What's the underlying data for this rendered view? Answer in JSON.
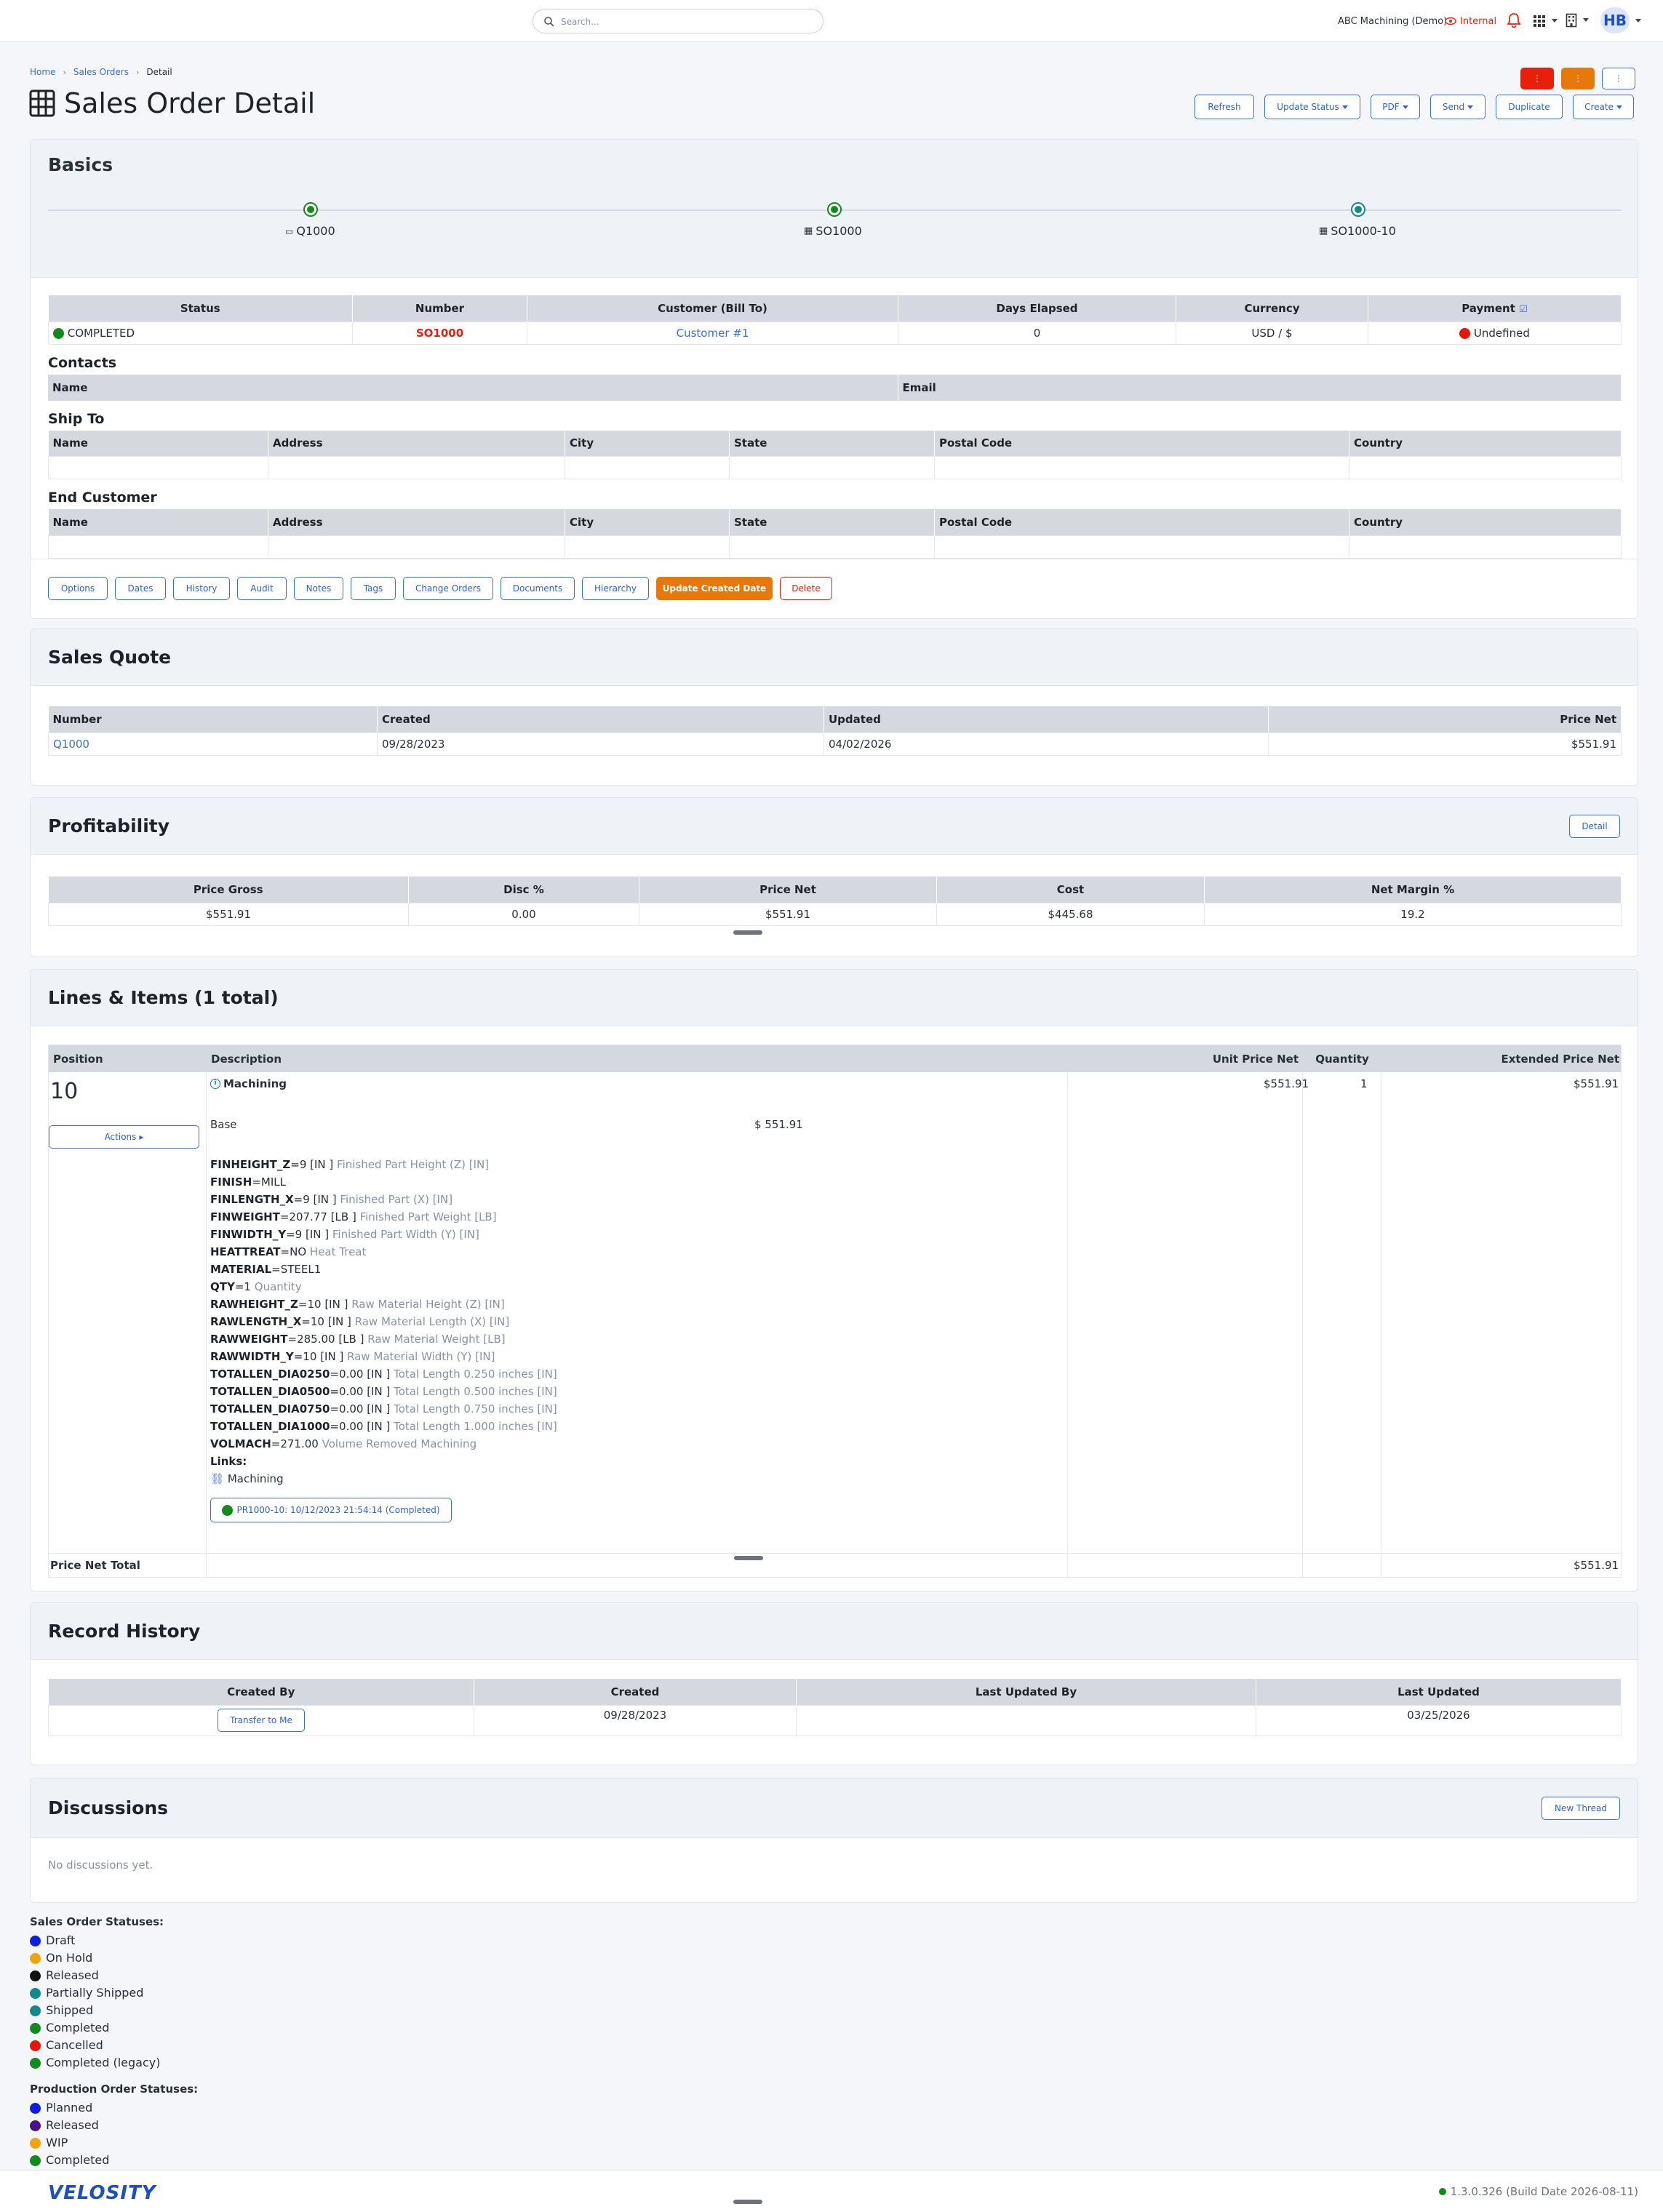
{
  "topbar": {
    "search_placeholder": "Search...",
    "company": "ABC Machining (Demo)",
    "internal_label": "Internal",
    "avatar": "HB"
  },
  "breadcrumb": [
    "Home",
    "Sales Orders",
    "Detail"
  ],
  "page_title": "Sales Order Detail",
  "header_buttons": {
    "refresh": "Refresh",
    "update_status": "Update Status",
    "pdf": "PDF",
    "send": "Send",
    "duplicate": "Duplicate",
    "create": "Create"
  },
  "basics": {
    "title": "Basics",
    "steps": [
      {
        "label": "Q1000"
      },
      {
        "label": "SO1000"
      },
      {
        "label": "SO1000-10"
      }
    ],
    "columns": [
      "Status",
      "Number",
      "Customer (Bill To)",
      "Days Elapsed",
      "Currency",
      "Payment"
    ],
    "row": {
      "status": "COMPLETED",
      "number": "SO1000",
      "customer": "Customer #1",
      "days": "0",
      "currency": "USD / $",
      "payment": "Undefined"
    },
    "contacts_title": "Contacts",
    "contacts_columns": [
      "Name",
      "Email"
    ],
    "ship_title": "Ship To",
    "end_title": "End Customer",
    "address_columns": [
      "Name",
      "Address",
      "City",
      "State",
      "Postal Code",
      "Country"
    ],
    "actions": [
      "Options",
      "Dates",
      "History",
      "Audit",
      "Notes",
      "Tags",
      "Change Orders",
      "Documents",
      "Hierarchy"
    ],
    "update_created_date": "Update Created Date",
    "delete": "Delete"
  },
  "sales_quote": {
    "title": "Sales Quote",
    "columns": [
      "Number",
      "Created",
      "Updated",
      "Price Net"
    ],
    "row": {
      "number": "Q1000",
      "created": "09/28/2023",
      "updated": "04/02/2026",
      "price_net": "$551.91"
    }
  },
  "profitability": {
    "title": "Profitability",
    "detail": "Detail",
    "columns": [
      "Price Gross",
      "Disc %",
      "Price Net",
      "Cost",
      "Net Margin %"
    ],
    "row": [
      "$551.91",
      "0.00",
      "$551.91",
      "$445.68",
      "19.2"
    ]
  },
  "lines": {
    "title": "Lines & Items (1 total)",
    "columns": [
      "Position",
      "Description",
      "Unit Price Net",
      "Quantity",
      "Extended Price Net"
    ],
    "position": "10",
    "actions": "Actions",
    "item_name": "Machining",
    "unit_price": "$551.91",
    "quantity": "1",
    "extended": "$551.91",
    "base_label": "Base",
    "base_value": "$ 551.91",
    "params": [
      {
        "k": "FINHEIGHT_Z",
        "v": "=9 [IN ]",
        "d": "Finished Part Height (Z) [IN]"
      },
      {
        "k": "FINISH",
        "v": "=MILL",
        "d": ""
      },
      {
        "k": "FINLENGTH_X",
        "v": "=9 [IN ]",
        "d": "Finished Part (X) [IN]"
      },
      {
        "k": "FINWEIGHT",
        "v": "=207.77 [LB ]",
        "d": "Finished Part Weight [LB]"
      },
      {
        "k": "FINWIDTH_Y",
        "v": "=9 [IN ]",
        "d": "Finished Part Width (Y) [IN]"
      },
      {
        "k": "HEATTREAT",
        "v": "=NO",
        "d": "Heat Treat"
      },
      {
        "k": "MATERIAL",
        "v": "=STEEL1",
        "d": ""
      },
      {
        "k": "QTY",
        "v": "=1",
        "d": "Quantity"
      },
      {
        "k": "RAWHEIGHT_Z",
        "v": "=10 [IN ]",
        "d": "Raw Material Height (Z) [IN]"
      },
      {
        "k": "RAWLENGTH_X",
        "v": "=10 [IN ]",
        "d": "Raw Material Length (X) [IN]"
      },
      {
        "k": "RAWWEIGHT",
        "v": "=285.00 [LB ]",
        "d": "Raw Material Weight [LB]"
      },
      {
        "k": "RAWWIDTH_Y",
        "v": "=10 [IN ]",
        "d": "Raw Material Width (Y) [IN]"
      },
      {
        "k": "TOTALLEN_DIA0250",
        "v": "=0.00 [IN ]",
        "d": "Total Length 0.250 inches [IN]"
      },
      {
        "k": "TOTALLEN_DIA0500",
        "v": "=0.00 [IN ]",
        "d": "Total Length 0.500 inches [IN]"
      },
      {
        "k": "TOTALLEN_DIA0750",
        "v": "=0.00 [IN ]",
        "d": "Total Length 0.750 inches [IN]"
      },
      {
        "k": "TOTALLEN_DIA1000",
        "v": "=0.00 [IN ]",
        "d": "Total Length 1.000 inches [IN]"
      },
      {
        "k": "VOLMACH",
        "v": "=271.00",
        "d": "Volume Removed Machining"
      }
    ],
    "links_label": "Links:",
    "link_item": "Machining",
    "pr_button": "PR1000-10: 10/12/2023 21:54:14 (Completed)",
    "total_label": "Price Net Total",
    "total_value": "$551.91"
  },
  "record_history": {
    "title": "Record History",
    "columns": [
      "Created By",
      "Created",
      "Last Updated By",
      "Last Updated"
    ],
    "transfer": "Transfer to Me",
    "created": "09/28/2023",
    "last_updated": "03/25/2026"
  },
  "discussions": {
    "title": "Discussions",
    "new_thread": "New Thread",
    "empty": "No discussions yet."
  },
  "so_statuses": {
    "title": "Sales Order Statuses:",
    "items": [
      {
        "label": "Draft",
        "color": "#0a1ee8"
      },
      {
        "label": "On Hold",
        "color": "#f0a30a"
      },
      {
        "label": "Released",
        "color": "#111111"
      },
      {
        "label": "Partially Shipped",
        "color": "#138a8a"
      },
      {
        "label": "Shipped",
        "color": "#138a8a"
      },
      {
        "label": "Completed",
        "color": "#138a1c"
      },
      {
        "label": "Cancelled",
        "color": "#e8140a"
      },
      {
        "label": "Completed (legacy)",
        "color": "#138a1c"
      }
    ]
  },
  "po_statuses": {
    "title": "Production Order Statuses:",
    "items": [
      {
        "label": "Planned",
        "color": "#0a1ee8"
      },
      {
        "label": "Released",
        "color": "#4b0f8a"
      },
      {
        "label": "WIP",
        "color": "#f0a30a"
      },
      {
        "label": "Completed",
        "color": "#138a1c"
      }
    ]
  },
  "footer": {
    "logo": "VELOSITY",
    "version": "1.3.0.326 (Build Date 2026-08-11)"
  },
  "colors": {
    "accent": "#3b6fd8",
    "danger": "#e8200a",
    "warning": "#e8780a",
    "success": "#138a1c"
  }
}
